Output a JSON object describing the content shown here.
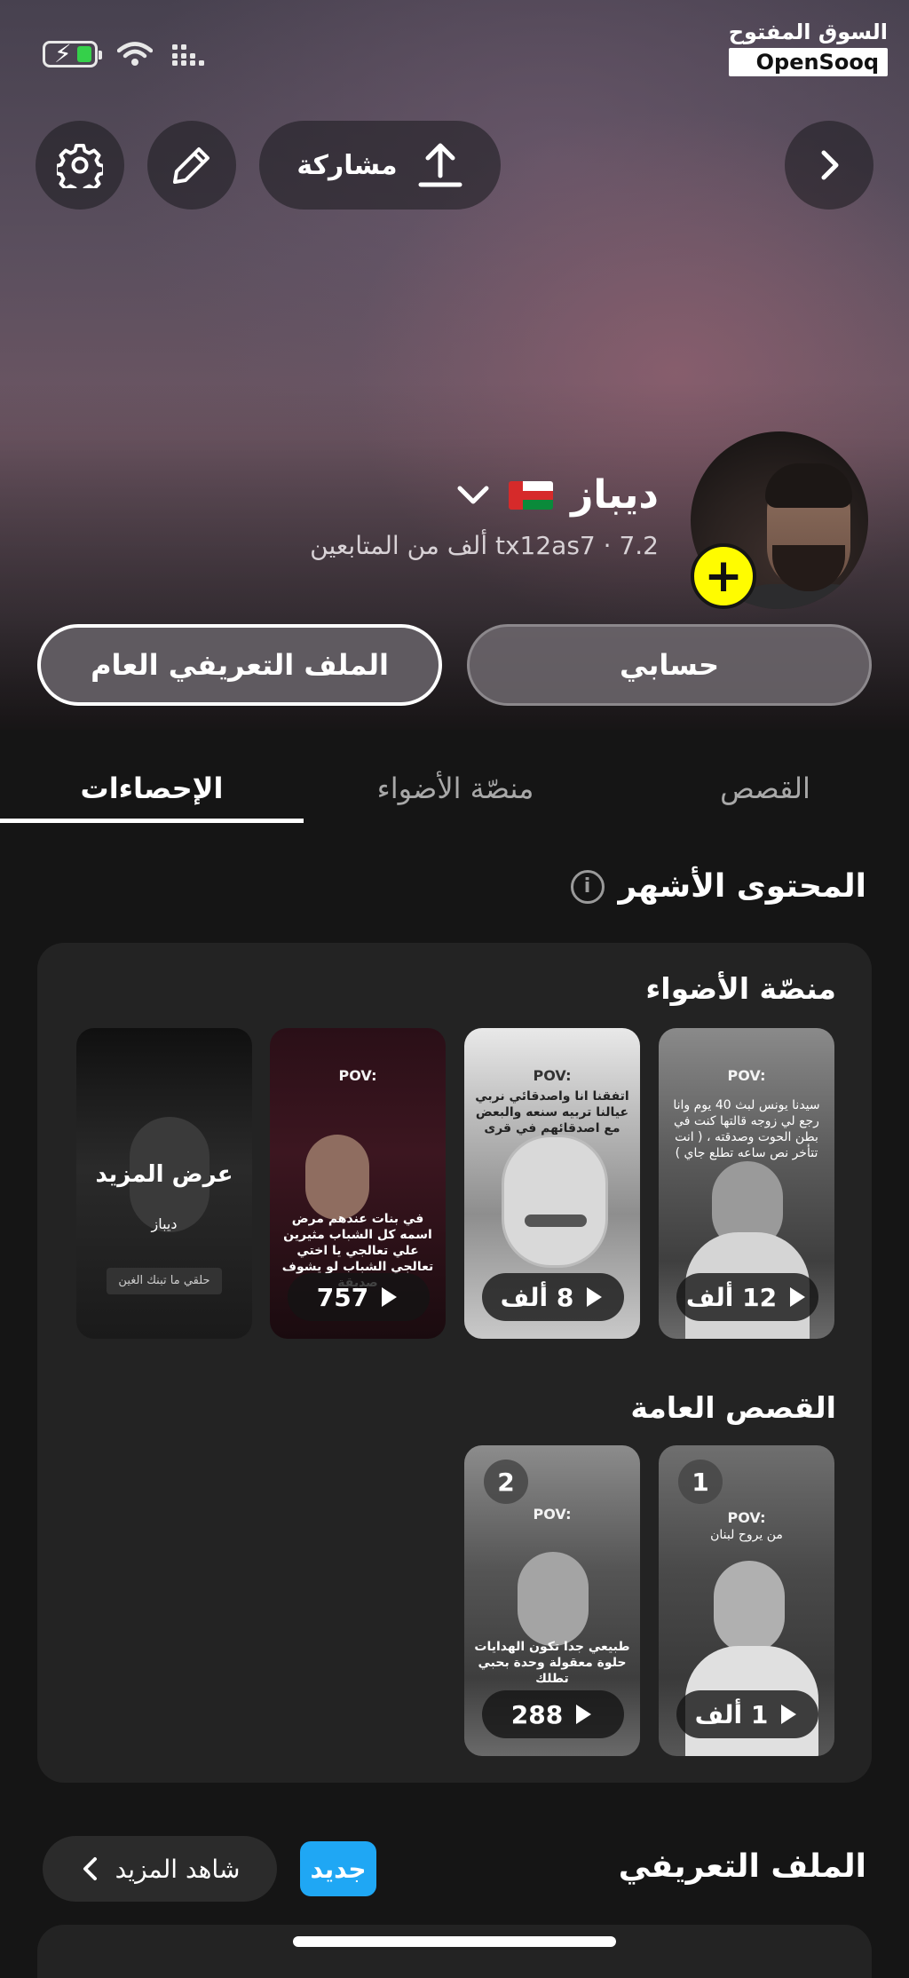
{
  "brand": {
    "arabic": "السوق المفتوح",
    "english": "OpenSooq"
  },
  "header": {
    "share_label": "مشاركة"
  },
  "profile": {
    "name": "ديباز",
    "username": "tx12as7",
    "followers": "7.2 ألف من المتابعين",
    "separator": "·",
    "my_account_label": "حسابي",
    "public_profile_label": "الملف التعريفي العام"
  },
  "tabs": [
    {
      "label": "القصص"
    },
    {
      "label": "منصّة الأضواء"
    },
    {
      "label": "الإحصاءات"
    }
  ],
  "top_content": {
    "title": "المحتوى الأشهر",
    "spotlight": {
      "title": "منصّة الأضواء",
      "items": [
        {
          "pov": "POV:",
          "caption": "سيدنا يونس لبث 40 يوم وانا رجع لي زوجه قالتها كنت في بطن الحوت وصدقته ، ( انت تتأخر نص ساعه تطلع جاي )",
          "views": "12 ألف"
        },
        {
          "pov": "POV:",
          "caption": "اتفقنا انا واصدقائي نربي عيالنا تربيه سنعه والبعض مع اصدقائهم في قرى العلم",
          "views": "8 ألف"
        },
        {
          "pov": "POV:",
          "caption": "في بنات عندهم مرض اسمه كل الشباب مثيرين علي تعالجي يا اختي تعالجي الشباب لو يشوف صديقة",
          "views": "757"
        },
        {
          "more_label": "عرض المزيد",
          "name": "ديباز",
          "tag": "حلقي ما تبنك الغين"
        }
      ]
    },
    "public_stories": {
      "title": "القصص العامة",
      "items": [
        {
          "rank": "1",
          "pov": "POV:",
          "caption": "من يروح لبنان",
          "views": "1 ألف"
        },
        {
          "rank": "2",
          "pov": "POV:",
          "caption": "طبيعي جدا تكون الهدايات حلوة معقولة وحدة بحبي تطلك",
          "views": "288"
        }
      ]
    }
  },
  "profile_section": {
    "title": "الملف التعريفي",
    "new_badge": "جديد",
    "see_more": "شاهد المزيد"
  },
  "colors": {
    "accent_yellow": "#fffc00",
    "new_badge_blue": "#1fa7f4",
    "battery_green": "#35d04a"
  }
}
